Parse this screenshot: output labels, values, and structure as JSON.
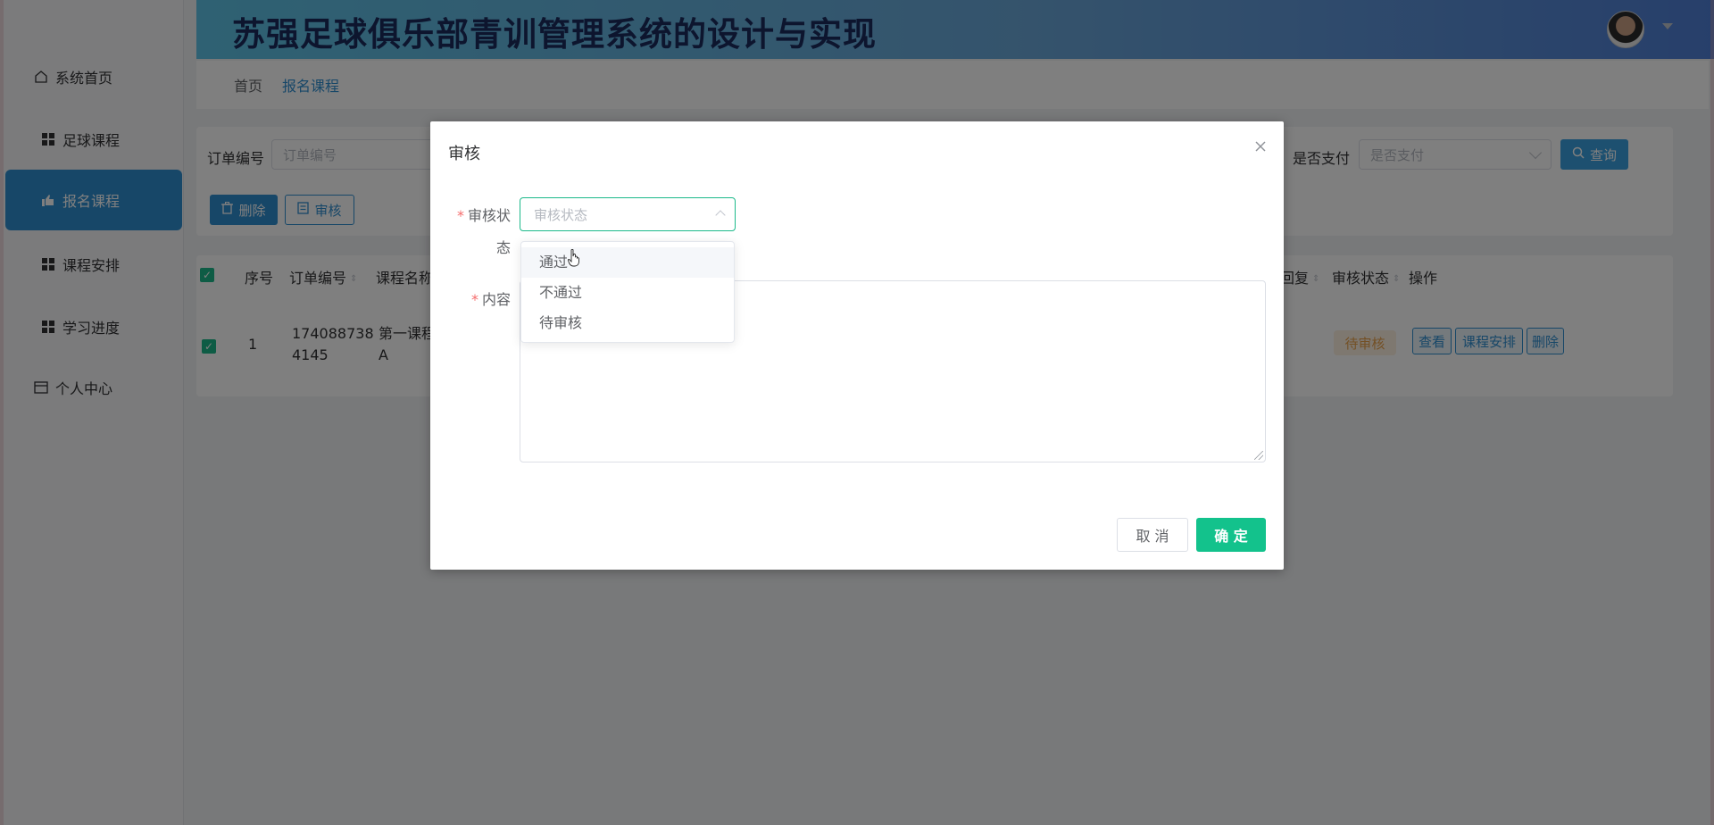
{
  "sidebar": {
    "items": [
      {
        "label": "系统首页",
        "icon": "home-icon"
      },
      {
        "label": "足球课程",
        "icon": "grid-icon"
      },
      {
        "label": "报名课程",
        "icon": "thumb-icon",
        "active": true
      },
      {
        "label": "课程安排",
        "icon": "grid-icon"
      },
      {
        "label": "学习进度",
        "icon": "grid-icon"
      },
      {
        "label": "个人中心",
        "icon": "card-icon"
      }
    ]
  },
  "header": {
    "title": "苏强足球俱乐部青训管理系统的设计与实现"
  },
  "breadcrumb": [
    "首页",
    "报名课程"
  ],
  "search": {
    "order_label": "订单编号",
    "order_placeholder": "订单编号",
    "paid_label": "是否支付",
    "paid_placeholder": "是否支付",
    "query_label": "查询",
    "delete_label": "删除",
    "audit_label": "审核"
  },
  "table": {
    "headers": [
      "序号",
      "订单编号",
      "课程名称",
      "回复",
      "审核状态",
      "操作"
    ],
    "rows": [
      {
        "index": "1",
        "order_no_line1": "174088738",
        "order_no_line2": "4145",
        "course_line1": "第一课程",
        "course_line2": "A",
        "status": "待审核",
        "actions": [
          "查看",
          "课程安排",
          "删除"
        ]
      }
    ]
  },
  "dialog": {
    "title": "审核",
    "status_label_line1": "审核状",
    "status_label_line2": "态",
    "status_placeholder": "审核状态",
    "content_label": "内容",
    "cancel_label": "取 消",
    "confirm_label": "确 定",
    "options": [
      "通过",
      "不通过",
      "待审核"
    ]
  },
  "colors": {
    "accent": "#2f8ed1",
    "confirm": "#13c28c",
    "pending_text": "#e8a14a"
  }
}
